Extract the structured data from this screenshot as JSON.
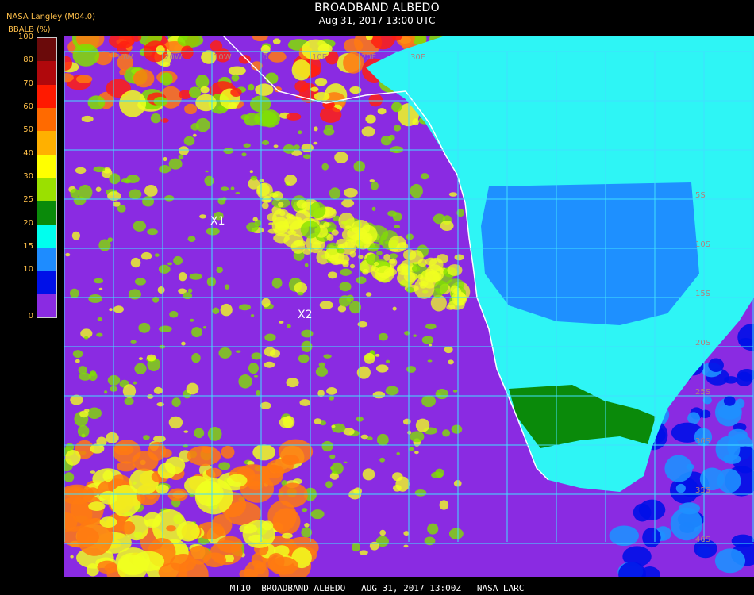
{
  "header": {
    "org": "NASA Langley (M04.0)",
    "title": "BROADBAND ALBEDO",
    "subtitle": "Aug 31, 2017 13:00 UTC"
  },
  "legend": {
    "title": "BBALB (%)",
    "ticks": [
      "100",
      "80",
      "70",
      "60",
      "50",
      "40",
      "30",
      "25",
      "20",
      "15",
      "10",
      "0"
    ],
    "colors": [
      "#6a0a0a",
      "#b0080c",
      "#ff1a00",
      "#ff6a00",
      "#ffb000",
      "#ffff00",
      "#9be000",
      "#0a8a0a",
      "#00ffee",
      "#1e8cff",
      "#0010e8",
      "#8a2be2"
    ]
  },
  "map": {
    "markers": [
      "X1",
      "X2"
    ],
    "lon_labels": [
      "30W",
      "20W",
      "10W",
      "0",
      "10E",
      "20E",
      "30E"
    ],
    "lat_labels": [
      "5S",
      "10S",
      "15S",
      "20S",
      "25S",
      "30S",
      "35S",
      "40S"
    ],
    "colors": {
      "ocean": "#8a2be2",
      "grid": "#40e0ff",
      "coast": "#ffffff",
      "land_cyan": "#2ef5f5",
      "land_blue": "#1e90ff",
      "land_green": "#0a8a0a",
      "cloud_yellow": "#f0ff20",
      "cloud_orange": "#ff7a10",
      "cloud_red": "#ff2010",
      "cloud_green": "#80e000"
    }
  },
  "footer": {
    "text": "MT10  BROADBAND ALBEDO   AUG 31, 2017 13:00Z   NASA LARC"
  }
}
